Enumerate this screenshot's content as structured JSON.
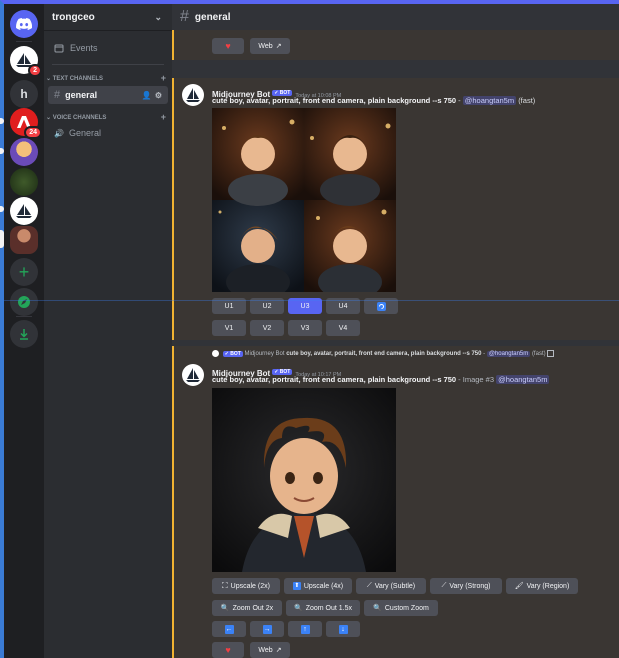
{
  "server_rail": {
    "home_icon": "discord-logo-icon",
    "servers": [
      {
        "name": "midjourney-sailboat-server",
        "badge": "2"
      },
      {
        "name": "h",
        "letter": "h"
      },
      {
        "name": "adobe-server",
        "badge": "24"
      },
      {
        "name": "portrait-server"
      },
      {
        "name": "forest-server"
      },
      {
        "name": "sailboat-server-2"
      },
      {
        "name": "person-server"
      }
    ],
    "add_server_icon": "plus-icon",
    "explore_icon": "compass-icon",
    "download_icon": "download-icon",
    "colors": {
      "accent_green": "#23a559"
    }
  },
  "channel_sidebar": {
    "guild_name": "trongceo",
    "events_label": "Events",
    "text_category": "TEXT CHANNELS",
    "voice_category": "VOICE CHANNELS",
    "text_channels": [
      {
        "name": "general",
        "active": true
      }
    ],
    "voice_channels": [
      {
        "name": "General"
      }
    ]
  },
  "header": {
    "channel_name": "general"
  },
  "messages": {
    "top_buttons": {
      "heart": "heart-icon",
      "web_label": "Web"
    },
    "msg1": {
      "author": "Midjourney Bot",
      "bot_tag": "✓ BOT",
      "timestamp": "Today at 10:08 PM",
      "prompt": "cute boy, avatar, portrait, front end camera, plain background --s 750",
      "separator": " - ",
      "mention": "@hoangtan5m",
      "speed": "(fast)",
      "upscale_buttons": [
        "U1",
        "U2",
        "U3",
        "U4"
      ],
      "selected_upscale": "U3",
      "variation_buttons": [
        "V1",
        "V2",
        "V3",
        "V4"
      ],
      "reroll_icon": "refresh-icon"
    },
    "msg2": {
      "reply_author": "Midjourney Bot",
      "reply_text": "cute boy, avatar, portrait, front end camera, plain background --s 750",
      "reply_mention": "@hoangtan5m",
      "reply_speed": "(fast)",
      "author": "Midjourney Bot",
      "bot_tag": "✓ BOT",
      "timestamp": "Today at 10:17 PM",
      "prompt": "cute boy, avatar, portrait, front end camera, plain background --s 750",
      "image_label": " - Image #3 ",
      "mention": "@hoangtan5m",
      "row1": [
        "Upscale (2x)",
        "Upscale (4x)",
        "Vary (Subtle)",
        "Vary (Strong)",
        "Vary (Region)"
      ],
      "row2": [
        "Zoom Out 2x",
        "Zoom Out 1.5x",
        "Custom Zoom"
      ],
      "arrows": [
        "arrow-left-icon",
        "arrow-right-icon",
        "arrow-up-icon",
        "arrow-down-icon"
      ],
      "web_label": "Web"
    }
  },
  "colors": {
    "brand": "#5865f2",
    "highlight": "#f0b232",
    "danger": "#f23f43"
  }
}
